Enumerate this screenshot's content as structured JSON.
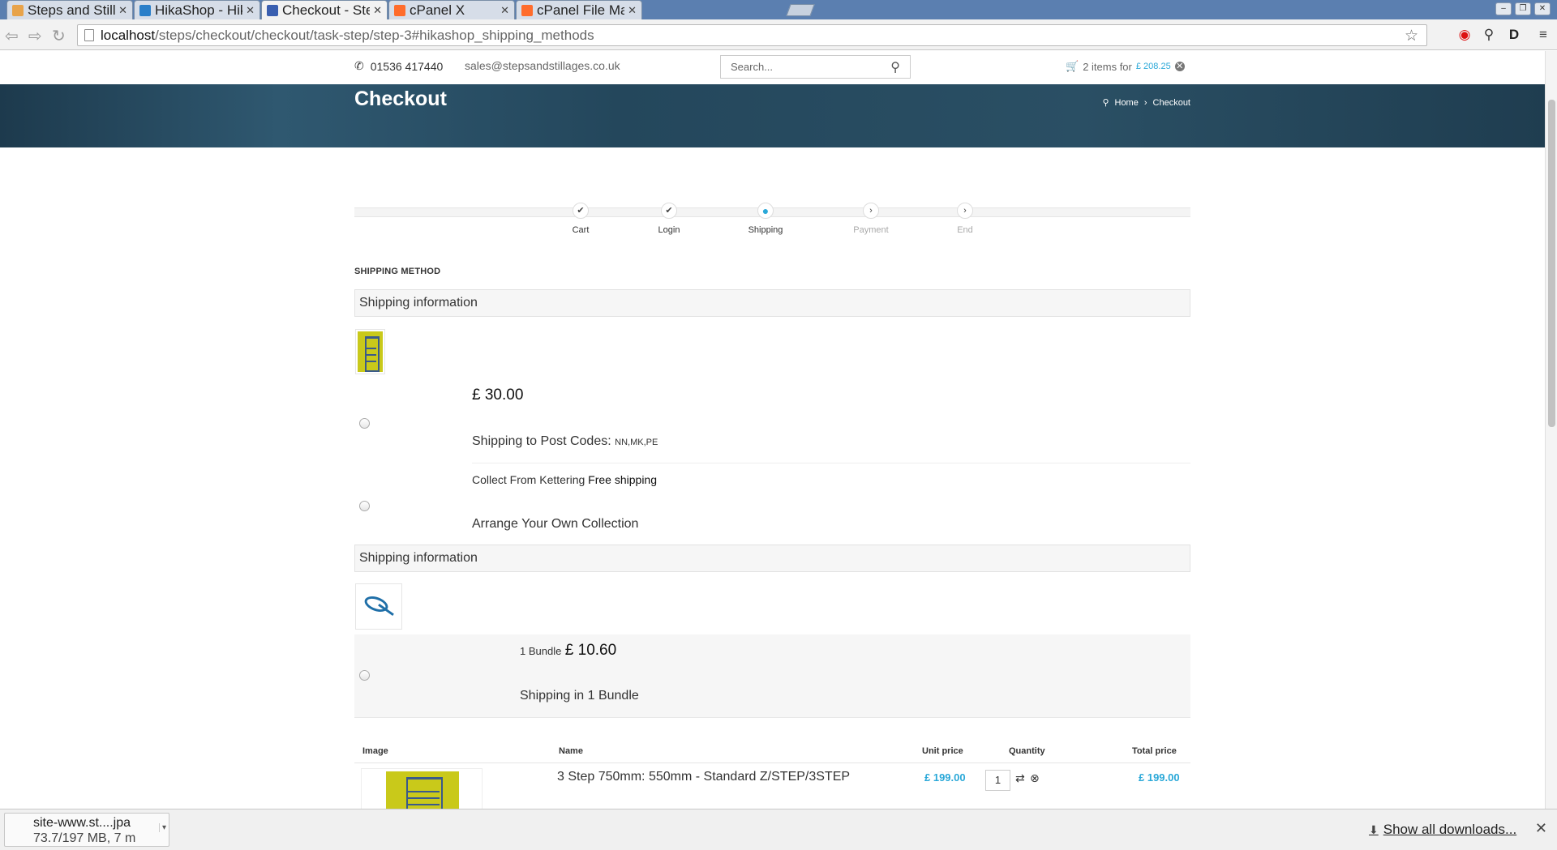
{
  "browser": {
    "tabs": [
      {
        "title": "Steps and Stillage",
        "favicon_color": "#e8a34a"
      },
      {
        "title": "HikaShop - HikaS",
        "favicon_color": "#2a7fc9"
      },
      {
        "title": "Checkout - Steps",
        "favicon_color": "#3a5fb0"
      },
      {
        "title": "cPanel X",
        "favicon_color": "#ff6c2c"
      },
      {
        "title": "cPanel File Manag",
        "favicon_color": "#ff6c2c"
      }
    ],
    "url_host": "localhost",
    "url_path": "/steps/checkout/checkout/task-step/step-3#hikashop_shipping_methods"
  },
  "site": {
    "phone": "01536 417440",
    "email": "sales@stepsandstillages.co.uk",
    "search_placeholder": "Search...",
    "cart_text": "2 items for",
    "cart_amount": "£ 208.25"
  },
  "banner": {
    "title": "Checkout",
    "breadcrumb": [
      "Home",
      "Checkout"
    ]
  },
  "steps": [
    {
      "label": "Cart",
      "state": "done"
    },
    {
      "label": "Login",
      "state": "done"
    },
    {
      "label": "Shipping",
      "state": "current"
    },
    {
      "label": "Payment",
      "state": "todo"
    },
    {
      "label": "End",
      "state": "todo"
    }
  ],
  "shipping": {
    "section_title": "SHIPPING METHOD",
    "group1": {
      "header": "Shipping information",
      "option1": {
        "price": "£ 30.00",
        "name": "Shipping to Post Codes:",
        "codes": "NN,MK,PE"
      },
      "option2": {
        "label": "Collect From Kettering",
        "free": "Free shipping",
        "name": "Arrange Your Own Collection"
      }
    },
    "group2": {
      "header": "Shipping information",
      "option1": {
        "bundle": "1 Bundle",
        "price": "£ 10.60",
        "name": "Shipping in 1 Bundle"
      }
    }
  },
  "table": {
    "headers": [
      "Image",
      "Name",
      "Unit price",
      "Quantity",
      "Total price"
    ],
    "rows": [
      {
        "name": "3 Step 750mm: 550mm - Standard Z/STEP/3STEP",
        "unit_price": "£ 199.00",
        "quantity": "1",
        "total_price": "£ 199.00"
      }
    ]
  },
  "downloads": {
    "file_name": "site-www.st....jpa",
    "file_progress": "73.7/197 MB, 7 m",
    "show_all": "Show all downloads..."
  },
  "colors": {
    "accent": "#2aa8d8",
    "banner": "#24475c"
  }
}
